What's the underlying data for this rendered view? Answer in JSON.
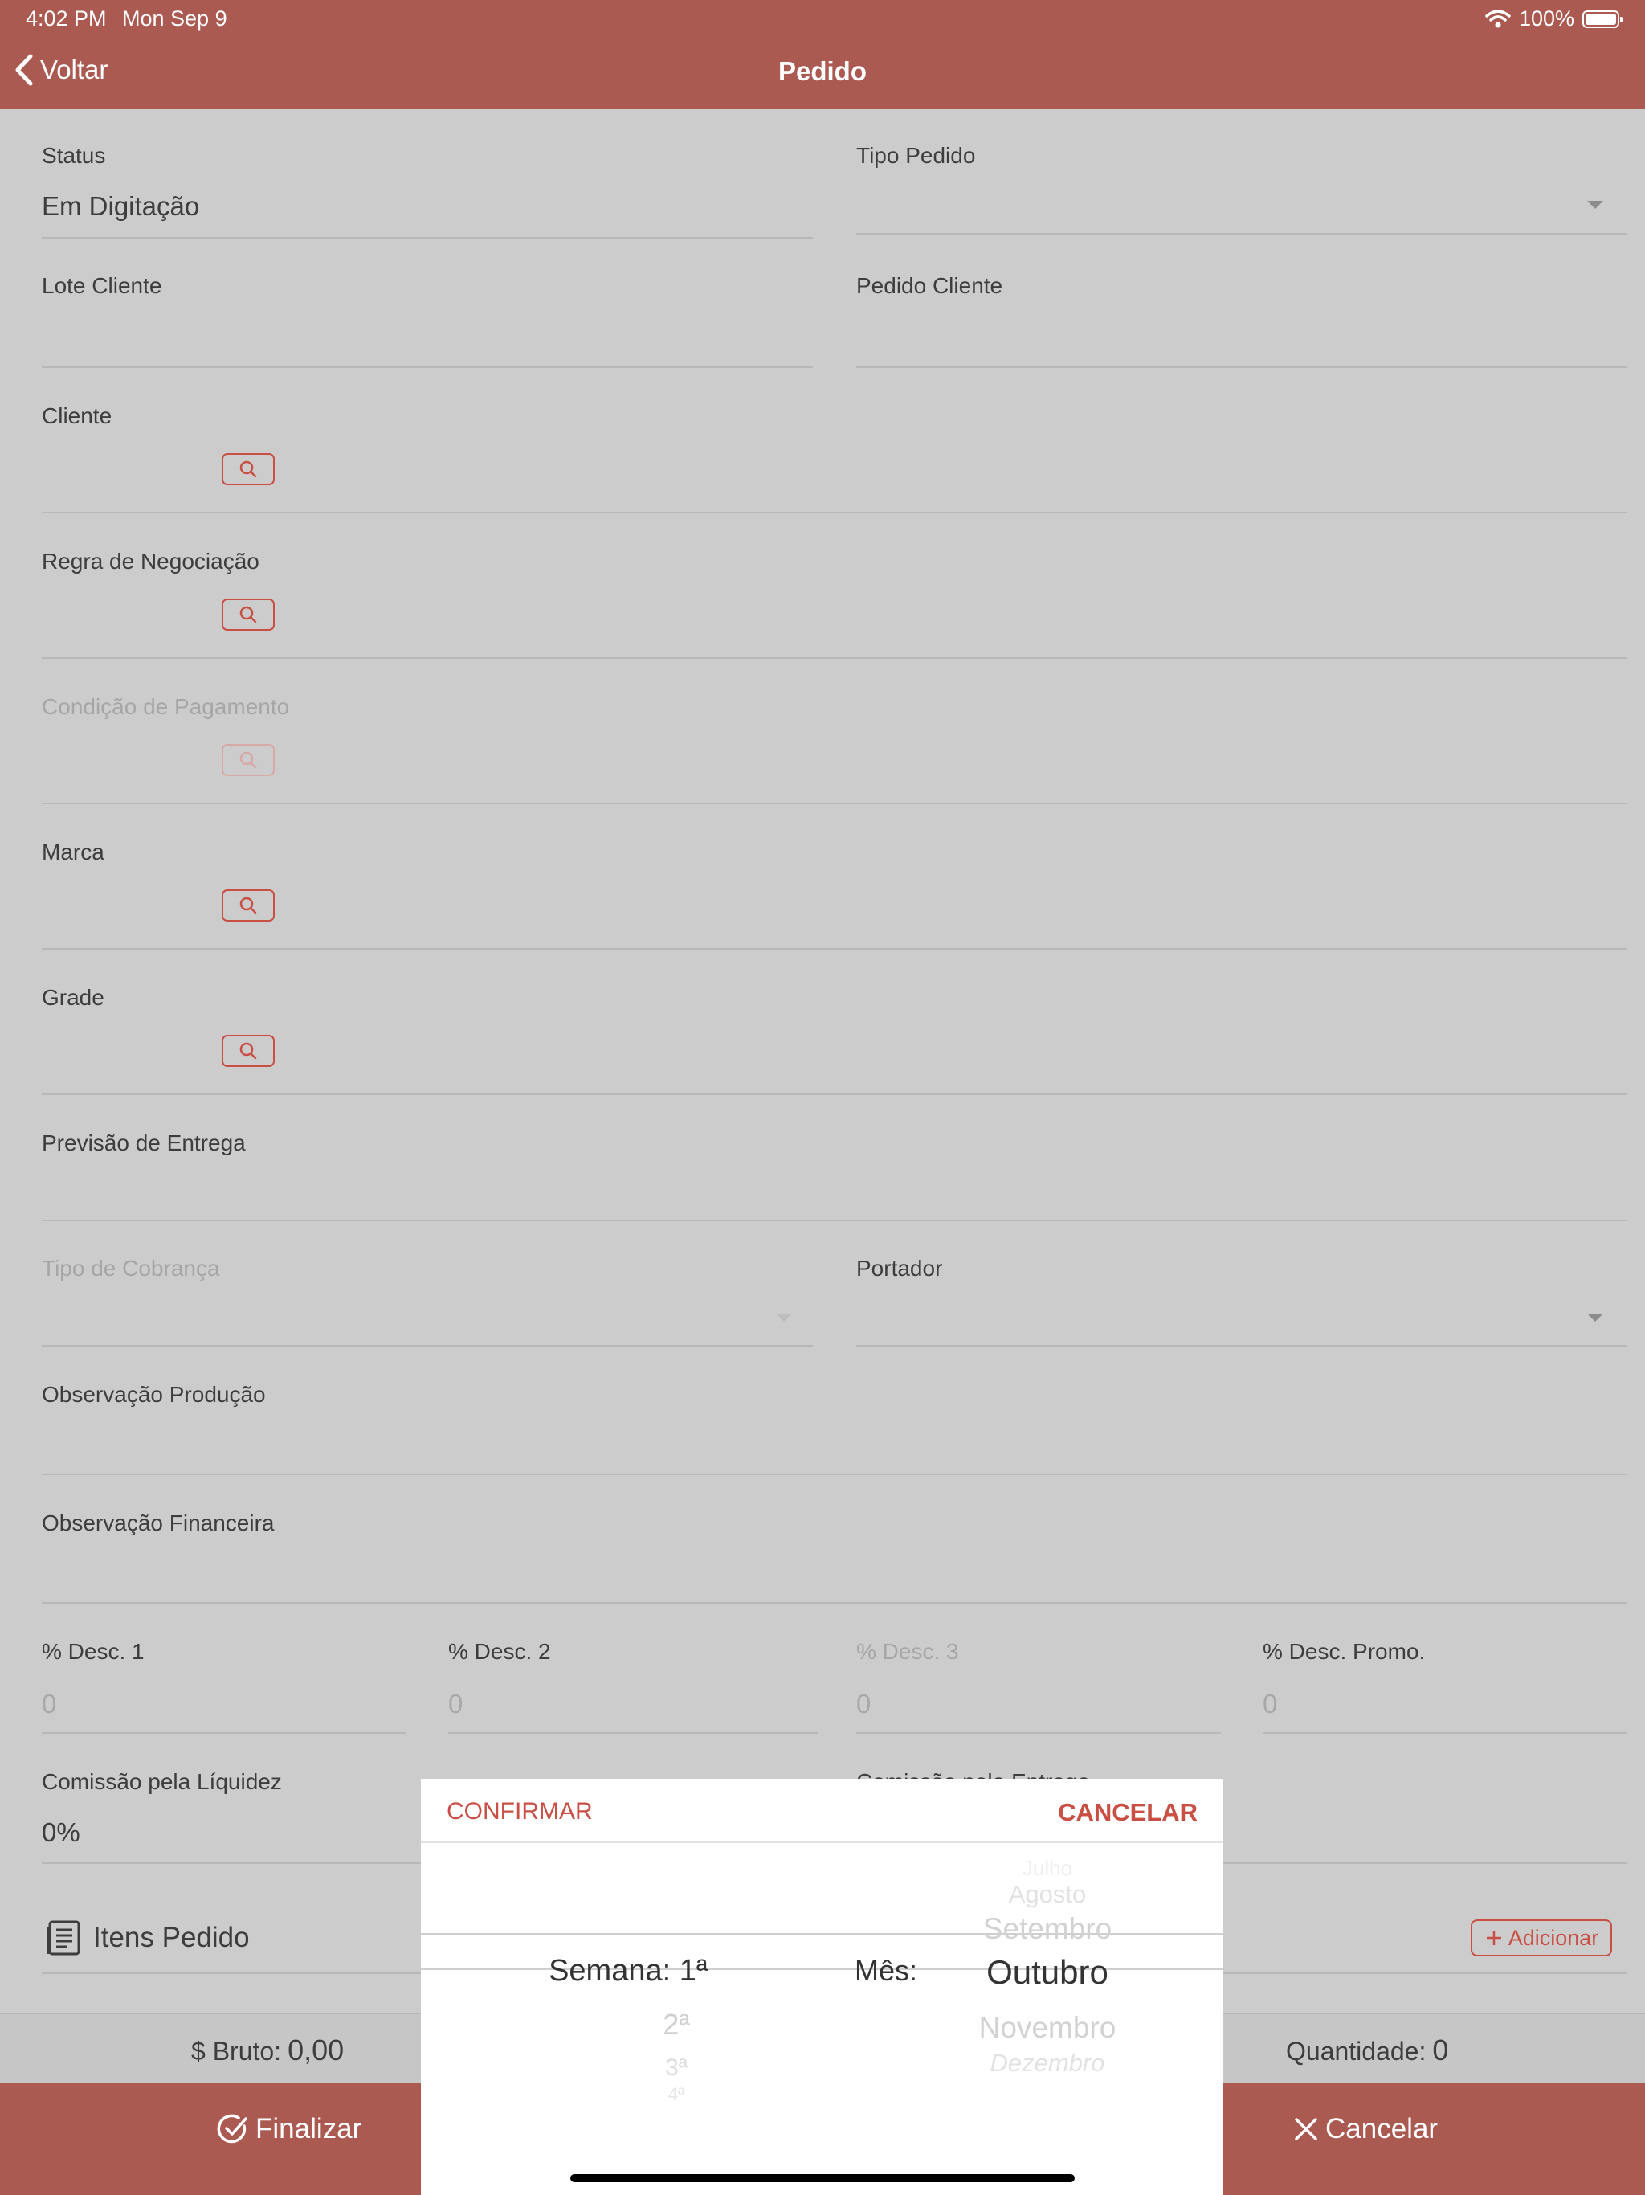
{
  "status_bar": {
    "time": "4:02 PM",
    "date": "Mon Sep 9",
    "battery": "100%"
  },
  "nav": {
    "back_label": "Voltar",
    "title": "Pedido"
  },
  "form": {
    "status": {
      "label": "Status",
      "value": "Em Digitação"
    },
    "tipo_pedido": {
      "label": "Tipo Pedido",
      "value": ""
    },
    "lote_cliente": {
      "label": "Lote Cliente",
      "value": ""
    },
    "pedido_cliente": {
      "label": "Pedido Cliente",
      "value": ""
    },
    "cliente": {
      "label": "Cliente"
    },
    "regra_negociacao": {
      "label": "Regra de Negociação"
    },
    "condicao_pagamento": {
      "label": "Condição de Pagamento"
    },
    "marca": {
      "label": "Marca"
    },
    "grade": {
      "label": "Grade"
    },
    "previsao_entrega": {
      "label": "Previsão de Entrega",
      "value": ""
    },
    "tipo_cobranca": {
      "label": "Tipo de Cobrança"
    },
    "portador": {
      "label": "Portador"
    },
    "observacao_producao": {
      "label": "Observação Produção"
    },
    "observacao_financeira": {
      "label": "Observação Financeira"
    },
    "desc1": {
      "label": "% Desc. 1",
      "placeholder": "0"
    },
    "desc2": {
      "label": "% Desc. 2",
      "placeholder": "0"
    },
    "desc3": {
      "label": "% Desc. 3",
      "placeholder": "0"
    },
    "desc_promo": {
      "label": "% Desc. Promo.",
      "placeholder": "0"
    },
    "comissao_liquidez": {
      "label": "Comissão pela Líquidez",
      "value": "0%"
    },
    "comissao_entrega_partial": "Comissão pela Entrega..."
  },
  "itens": {
    "title": "Itens Pedido",
    "add_label": "Adicionar"
  },
  "totals": {
    "bruto_label": "$ Bruto:",
    "bruto_value": "0,00",
    "quantidade_label": "Quantidade:",
    "quantidade_value": "0"
  },
  "actions": {
    "finalizar": "Finalizar",
    "cancelar": "Cancelar"
  },
  "picker": {
    "confirm": "CONFIRMAR",
    "cancel": "CANCELAR",
    "semana_label": "Semana:",
    "semana_selected": "1ª",
    "semana_below": [
      "2ª",
      "3ª",
      "4ª"
    ],
    "mes_label": "Mês:",
    "mes_above": [
      "Julho",
      "Agosto",
      "Setembro"
    ],
    "mes_selected": "Outubro",
    "mes_below": [
      "Novembro",
      "Dezembro"
    ]
  },
  "colors": {
    "accent": "#ab5a51",
    "button_red": "#c94f44",
    "background": "#cccccc"
  }
}
